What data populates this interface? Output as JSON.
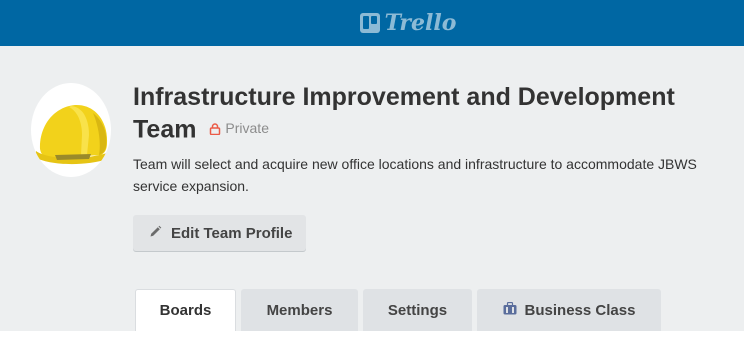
{
  "header": {
    "logo_text": "Trello"
  },
  "team": {
    "name": "Infrastructure Improvement and Development Team",
    "privacy_label": "Private",
    "description": "Team will select and acquire new office locations and infrastructure to accommodate JBWS service expansion.",
    "edit_button_label": "Edit Team Profile"
  },
  "tabs": [
    {
      "label": "Boards",
      "active": true
    },
    {
      "label": "Members",
      "active": false
    },
    {
      "label": "Settings",
      "active": false
    },
    {
      "label": "Business Class",
      "active": false,
      "icon": "briefcase-icon"
    }
  ],
  "colors": {
    "header_bg": "#0067a3",
    "page_bg": "#edeff0",
    "privacy_lock": "#eb5a46",
    "business_icon": "#5a6d9c",
    "helmet": "#f2d21b"
  },
  "icons": {
    "logo": "trello-logo-icon",
    "privacy": "lock-icon",
    "edit": "pencil-icon",
    "avatar": "hard-hat-icon"
  }
}
